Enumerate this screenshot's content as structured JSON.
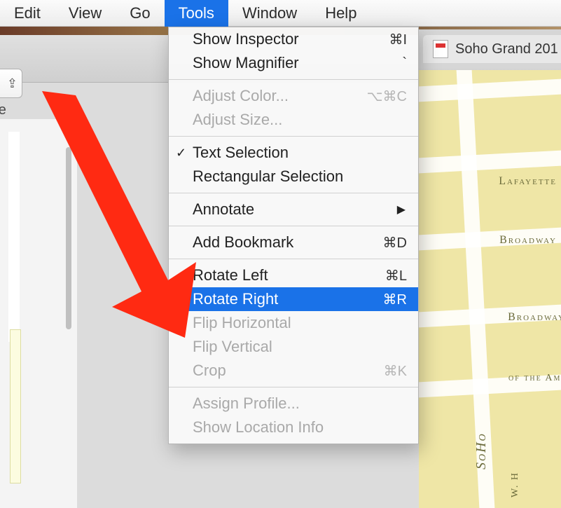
{
  "menubar": {
    "items": [
      {
        "label": "Edit"
      },
      {
        "label": "View"
      },
      {
        "label": "Go"
      },
      {
        "label": "Tools",
        "active": true
      },
      {
        "label": "Window"
      },
      {
        "label": "Help"
      }
    ]
  },
  "toolbar": {
    "share_label": "are"
  },
  "tab": {
    "title": "Soho Grand 201"
  },
  "dropdown": {
    "items": [
      {
        "label": "Show Inspector",
        "shortcut": "⌘I"
      },
      {
        "label": "Show Magnifier",
        "shortcut": "`"
      },
      {
        "sep": true
      },
      {
        "label": "Adjust Color...",
        "shortcut": "⌥⌘C",
        "disabled": true
      },
      {
        "label": "Adjust Size...",
        "disabled": true
      },
      {
        "sep": true
      },
      {
        "label": "Text Selection",
        "checked": true
      },
      {
        "label": "Rectangular Selection"
      },
      {
        "sep": true
      },
      {
        "label": "Annotate",
        "submenu": true
      },
      {
        "sep": true
      },
      {
        "label": "Add Bookmark",
        "shortcut": "⌘D"
      },
      {
        "sep": true
      },
      {
        "label": "Rotate Left",
        "shortcut": "⌘L"
      },
      {
        "label": "Rotate Right",
        "shortcut": "⌘R",
        "highlight": true
      },
      {
        "label": "Flip Horizontal",
        "disabled": true
      },
      {
        "label": "Flip Vertical",
        "disabled": true
      },
      {
        "label": "Crop",
        "shortcut": "⌘K",
        "disabled": true
      },
      {
        "sep": true
      },
      {
        "label": "Assign Profile...",
        "disabled": true
      },
      {
        "label": "Show Location Info",
        "disabled": true
      }
    ]
  },
  "map": {
    "streets": {
      "lafayette": "Lafayette",
      "broadway1": "Broadway",
      "broadway2": "Broadway",
      "americas": "of the Americas",
      "soho": "SoHo",
      "wh": "W. H"
    }
  },
  "arrow": {
    "color": "#ff2a12"
  }
}
